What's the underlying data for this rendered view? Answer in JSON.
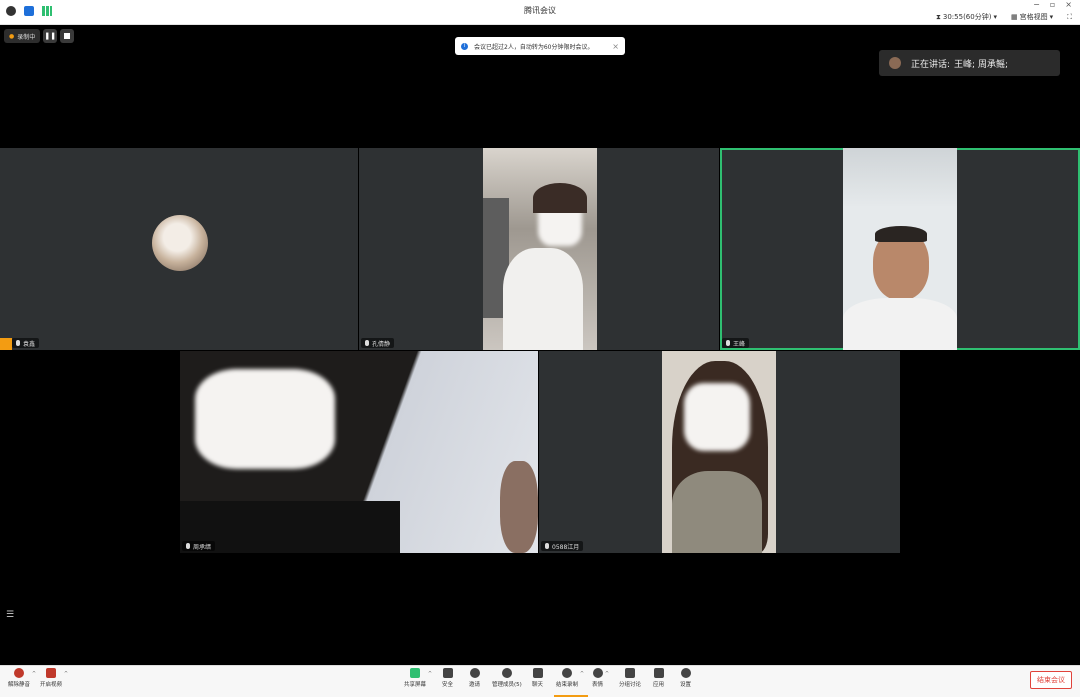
{
  "window": {
    "title": "腾讯会议"
  },
  "titlebar": {
    "timer": "30:55(60分钟)",
    "view_mode": "宫格视图",
    "minimize": "−",
    "maximize": "▫",
    "close": "×"
  },
  "recording": {
    "label": "录制中"
  },
  "toast": {
    "text": "会议已超过2人，自动转为60分钟限时会议。"
  },
  "speaking": {
    "prefix": "正在讲话:",
    "names": "王峰; 周承鳐;"
  },
  "participants": [
    {
      "name": "袁鑫"
    },
    {
      "name": "孔倩静"
    },
    {
      "name": "王峰"
    },
    {
      "name": "周承缙"
    },
    {
      "name": "0588江月"
    }
  ],
  "toolbar": {
    "mute": "解除静音",
    "video": "开启视频",
    "share": "共享屏幕",
    "security": "安全",
    "invite": "邀请",
    "members": "管理成员(5)",
    "chat": "聊天",
    "record": "结束录制",
    "reactions": "表情",
    "breakout": "分组讨论",
    "apps": "应用",
    "settings": "设置",
    "leave": "结束会议"
  },
  "colors": {
    "active_border": "#2fbf71",
    "leave": "#e0433b",
    "host_badge": "#f39c12"
  }
}
